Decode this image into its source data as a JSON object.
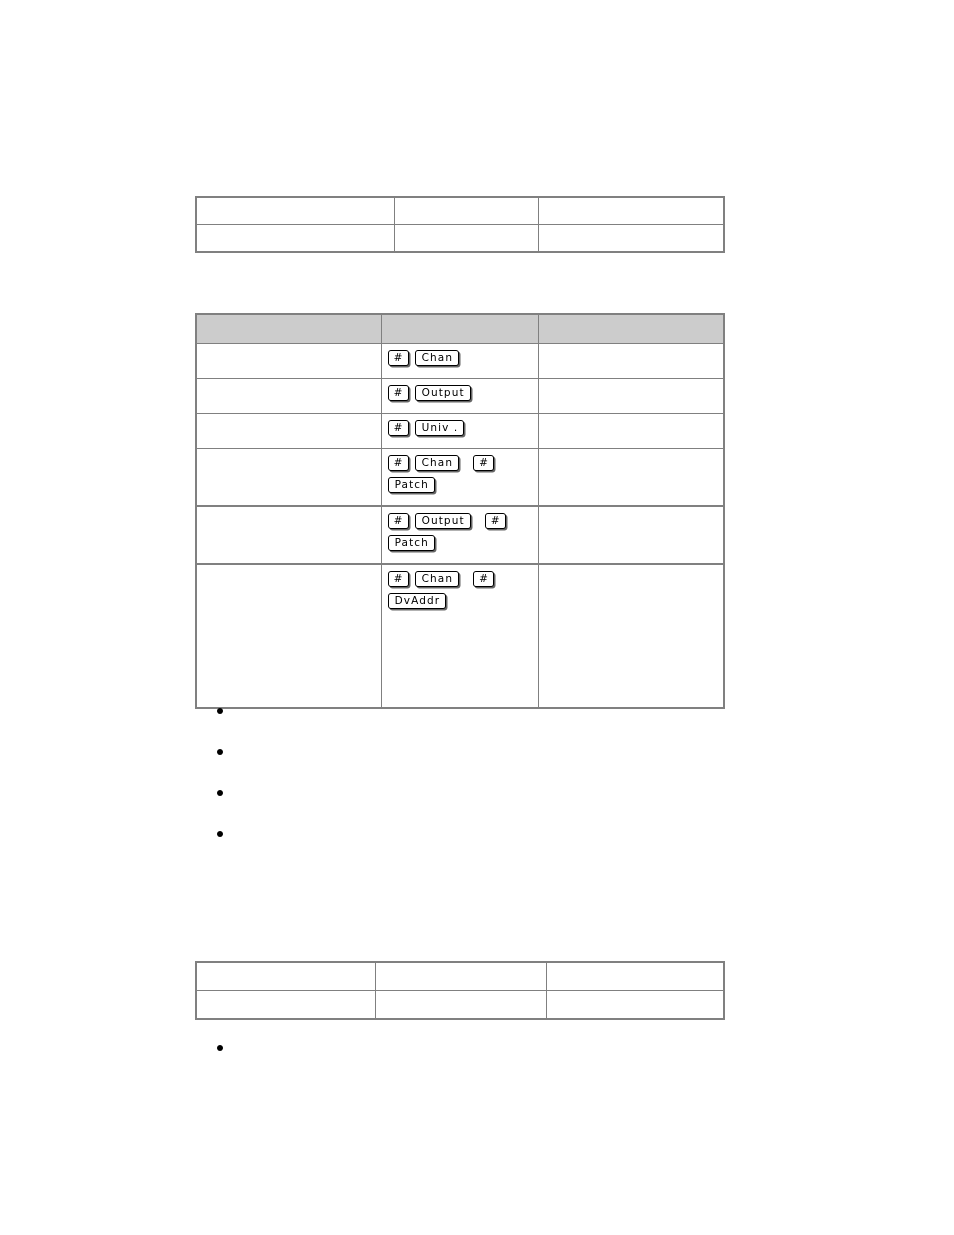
{
  "document": {
    "page_background": "#ffffff",
    "table_border_color": "#808080",
    "header_fill_color": "#cccccc",
    "keycap_border_color": "#000000",
    "keycap_shadow_color": "#666666"
  },
  "table_top": {
    "name": "top-table",
    "columns": [
      "",
      "",
      ""
    ],
    "rows": [
      {
        "cells": [
          "",
          "",
          ""
        ]
      },
      {
        "cells": [
          "",
          "",
          ""
        ]
      }
    ]
  },
  "table_keys": {
    "name": "key-sequence-table",
    "header": {
      "cells": [
        "",
        "",
        ""
      ]
    },
    "rows": [
      {
        "label": "",
        "note": "",
        "keys": [
          {
            "line": [
              {
                "text": "#",
                "type": "hash"
              },
              {
                "text": "Chan",
                "type": "label"
              }
            ]
          }
        ]
      },
      {
        "label": "",
        "note": "",
        "keys": [
          {
            "line": [
              {
                "text": "#",
                "type": "hash"
              },
              {
                "text": "Output",
                "type": "label"
              }
            ]
          }
        ]
      },
      {
        "label": "",
        "note": "",
        "keys": [
          {
            "line": [
              {
                "text": "#",
                "type": "hash"
              },
              {
                "text": "Univ .",
                "type": "label"
              }
            ]
          }
        ]
      },
      {
        "label": "",
        "note": "",
        "keys": [
          {
            "line": [
              {
                "text": "#",
                "type": "hash"
              },
              {
                "text": "Chan",
                "type": "label"
              },
              {
                "text": "#",
                "type": "hash"
              }
            ]
          },
          {
            "line": [
              {
                "text": "Patch",
                "type": "label"
              }
            ]
          }
        ]
      },
      {
        "label": "",
        "note": "",
        "section_start": true,
        "keys": [
          {
            "line": [
              {
                "text": "#",
                "type": "hash"
              },
              {
                "text": "Output",
                "type": "label"
              },
              {
                "text": "#",
                "type": "hash"
              }
            ]
          },
          {
            "line": [
              {
                "text": "Patch",
                "type": "label"
              }
            ]
          }
        ]
      },
      {
        "label": "",
        "note": "",
        "section_start": true,
        "tall": true,
        "keys": [
          {
            "line": [
              {
                "text": "#",
                "type": "hash"
              },
              {
                "text": "Chan",
                "type": "label"
              },
              {
                "text": "#",
                "type": "hash"
              }
            ]
          },
          {
            "line": [
              {
                "text": "DvAddr",
                "type": "label"
              }
            ]
          }
        ]
      }
    ]
  },
  "bullets_main": {
    "name": "bullet-list-main",
    "items": [
      "",
      "",
      "",
      ""
    ]
  },
  "table_bottom": {
    "name": "bottom-table",
    "rows": [
      {
        "cells": [
          "",
          "",
          ""
        ]
      },
      {
        "cells": [
          "",
          "",
          ""
        ]
      }
    ]
  },
  "bullets_after": {
    "name": "bullet-list-after",
    "items": [
      ""
    ]
  }
}
